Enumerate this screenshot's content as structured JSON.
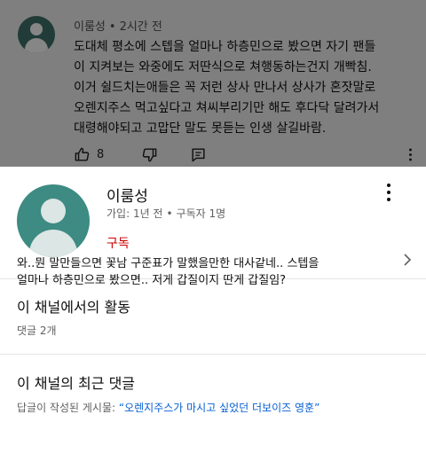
{
  "comment": {
    "author": "이룸성",
    "dot": "•",
    "time": "2시간 전",
    "lines": [
      "도대체 평소에 스텝을 얼마나 하층민으로 봤으면 자기 팬들",
      "이 지켜보는 와중에도 저딴식으로 쳐행동하는건지 개빡침.",
      "이거 쉴드치는애들은 꼭 저런 상사 만나서 상사가 혼잣말로",
      "오렌지주스 먹고싶다고 쳐씨부리기만 해도 후다닥 달려가서",
      "대령해야되고 고맙단 말도 못듣는 인생 살길바람."
    ],
    "like_count": "8",
    "icons": [
      "thumbs-up-icon",
      "thumbs-down-icon",
      "reply-icon",
      "more-vertical-icon"
    ]
  },
  "channel": {
    "name": "이룸성",
    "joined": "가입: 1년 전",
    "dot": "•",
    "subscribers": "구독자 1명",
    "subscribe_label": "구독",
    "subscribe_color": "#cc0000"
  },
  "activity": {
    "title": "이 채널에서의 활동",
    "comments_count": "댓글 2개"
  },
  "recent": {
    "title": "이 채널의 최근 댓글",
    "posted_on_label": "답글이 작성된 게시물:",
    "video_title": "“오렌지주스가 마시고 싶었던 더보이즈 영훈”",
    "reply_lines": [
      "와..뭔 말만들으면 꽃남 구준표가 말했을만한 대사같네.. 스텝을",
      "얼마나 하층민으로 봤으면.. 저게 갑질이지 딴게 갑질임?"
    ]
  }
}
